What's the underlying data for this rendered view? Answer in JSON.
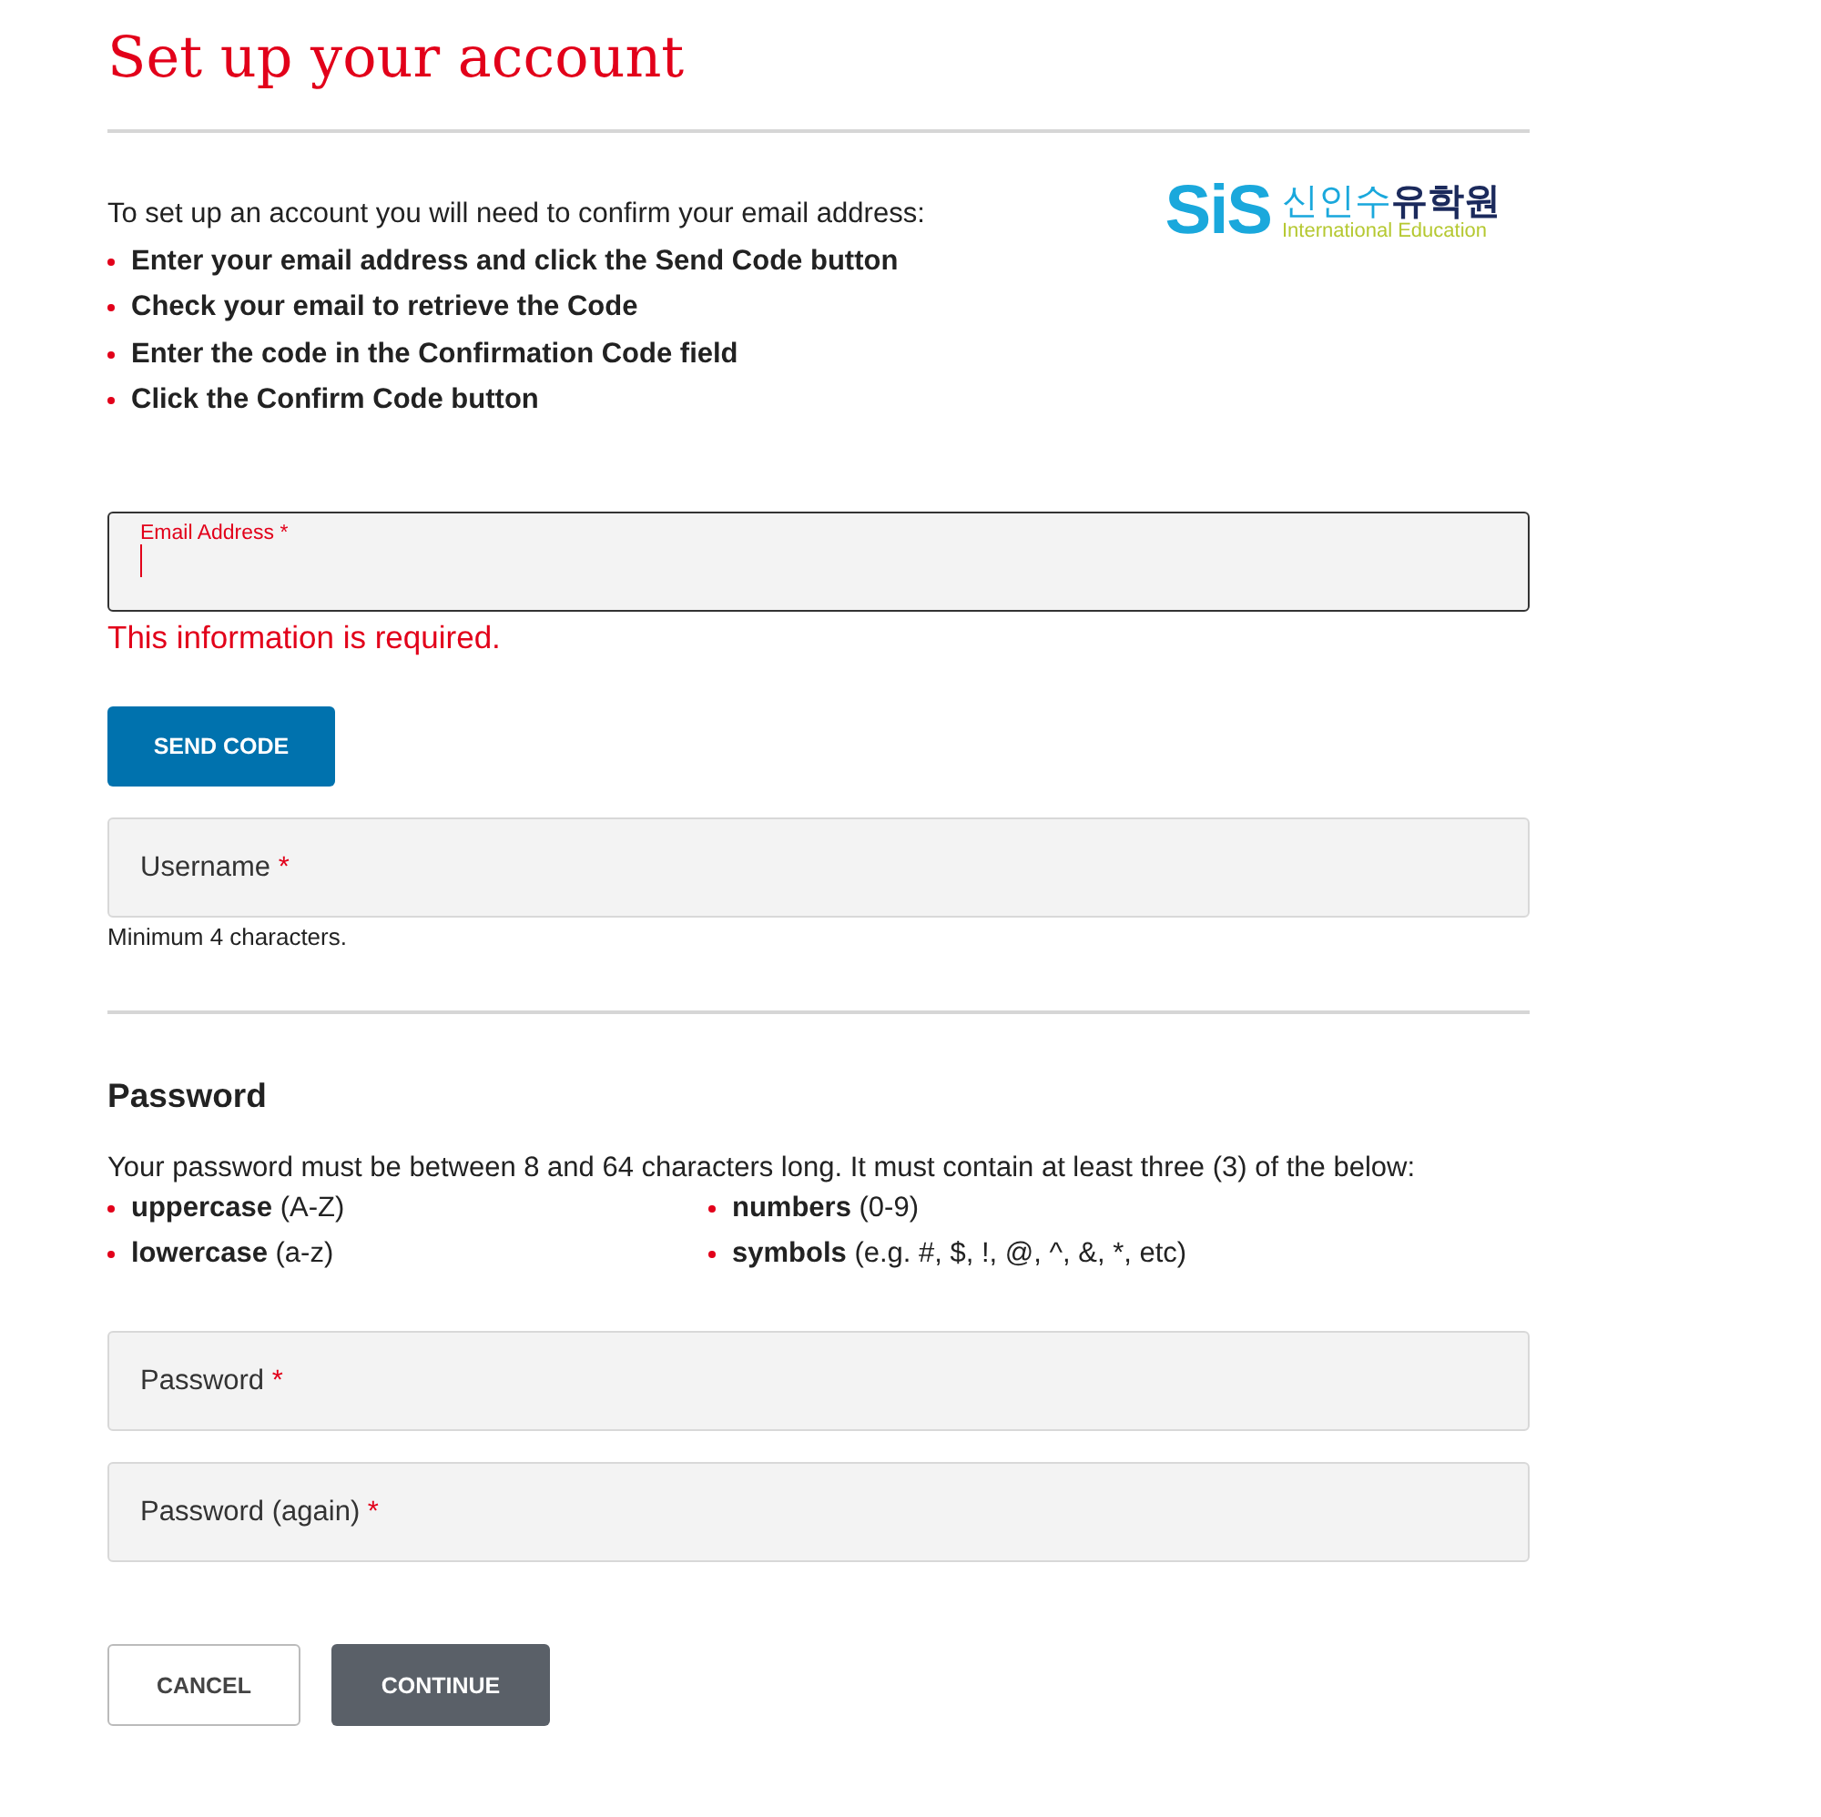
{
  "title": "Set up your account",
  "logo": {
    "mark": "SiS",
    "name_a": "신인수",
    "name_b": "유학원",
    "tagline": "International Education"
  },
  "intro": "To set up an account you will need to confirm your email address:",
  "steps": [
    "Enter your email address and click the Send Code button",
    "Check your email to retrieve the Code",
    "Enter the code in the Confirmation Code field",
    "Click the Confirm Code button"
  ],
  "email_field": {
    "label": "Email Address",
    "marker": "*",
    "focused": true,
    "error": "This information is required."
  },
  "send_button": "SEND CODE",
  "username_field": {
    "label": "Username",
    "marker": "*",
    "focused": false,
    "hint": "Minimum 4 characters."
  },
  "password_section": {
    "heading": "Password",
    "description": "Your password must be between 8 and 64 characters long. It must contain at least three (3) of the below:",
    "rules": [
      "**uppercase** (A-Z)",
      "**numbers** (0-9)",
      "**lowercase** (a-z)",
      "**symbols** (e.g. #, $, !, @, ^, &, *, etc)"
    ],
    "fields": [
      {
        "label": "Password",
        "marker": "*",
        "focused": false
      },
      {
        "label": "Password (again)",
        "marker": "*",
        "focused": false
      }
    ]
  },
  "buttons": [
    {
      "label": "CANCEL",
      "kind": "secondary"
    },
    {
      "label": "CONTINUE",
      "kind": "primary"
    }
  ]
}
